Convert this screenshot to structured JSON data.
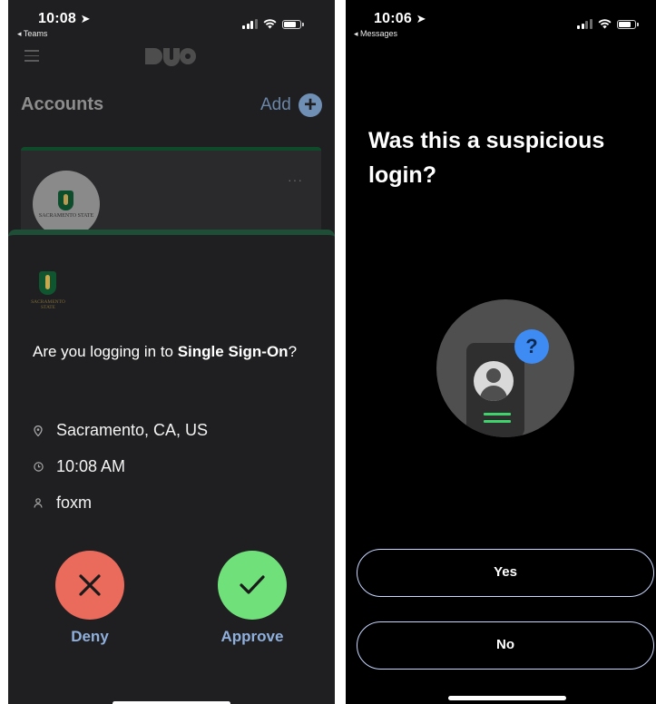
{
  "left": {
    "status": {
      "time": "10:08",
      "back_label": "◂ Teams"
    },
    "header": {
      "logo": "DUO"
    },
    "accounts": {
      "title": "Accounts",
      "add_label": "Add",
      "add_icon": "+"
    },
    "card": {
      "menu_glyph": "···",
      "avatar_text": "SACRAMENTO STATE"
    },
    "request": {
      "logo_text": "SACRAMENTO STATE",
      "question_prefix": "Are you logging in to ",
      "question_app": "Single Sign-On",
      "question_suffix": "?",
      "location": "Sacramento, CA, US",
      "time": "10:08 AM",
      "user": "foxm",
      "deny_label": "Deny",
      "approve_label": "Approve"
    },
    "colors": {
      "deny": "#ea6a5c",
      "approve": "#6fe07a",
      "action_text": "#8fb0dd"
    }
  },
  "right": {
    "status": {
      "time": "10:06",
      "back_label": "◂ Messages"
    },
    "title": "Was this a suspicious login?",
    "question_mark": "?",
    "yes_label": "Yes",
    "no_label": "No",
    "colors": {
      "badge": "#3d8bf3",
      "accent_line": "#3ed36b",
      "pill_border": "#c8d7ff"
    }
  }
}
